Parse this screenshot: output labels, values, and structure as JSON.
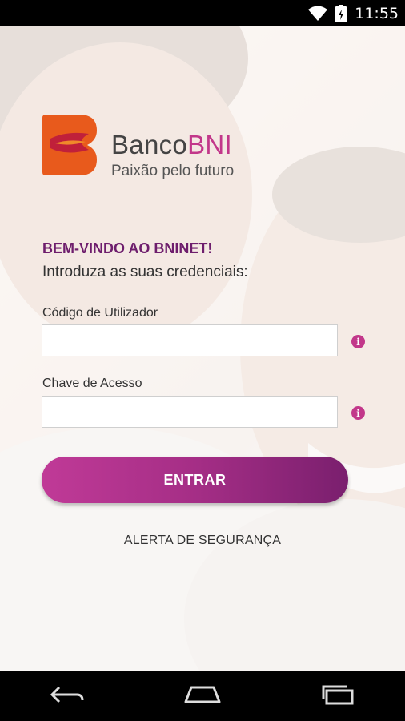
{
  "status_bar": {
    "time": "11:55"
  },
  "brand": {
    "name_prefix": "Banco",
    "name_bold": "BNI",
    "tagline": "Paixão pelo futuro"
  },
  "login": {
    "welcome": "BEM-VINDO AO BNINET!",
    "instructions": "Introduza as suas credenciais:",
    "user_code_label": "Código de Utilizador",
    "user_code_value": "",
    "access_key_label": "Chave de Acesso",
    "access_key_value": "",
    "info_glyph": "i",
    "submit_label": "ENTRAR",
    "security_alert": "ALERTA DE SEGURANÇA"
  },
  "colors": {
    "brand_purple": "#6e1e6d",
    "accent_magenta": "#c2378a",
    "logo_orange": "#e85a1c"
  },
  "icons": [
    "wifi-icon",
    "battery-icon",
    "info-icon",
    "back-icon",
    "home-icon",
    "recents-icon"
  ]
}
